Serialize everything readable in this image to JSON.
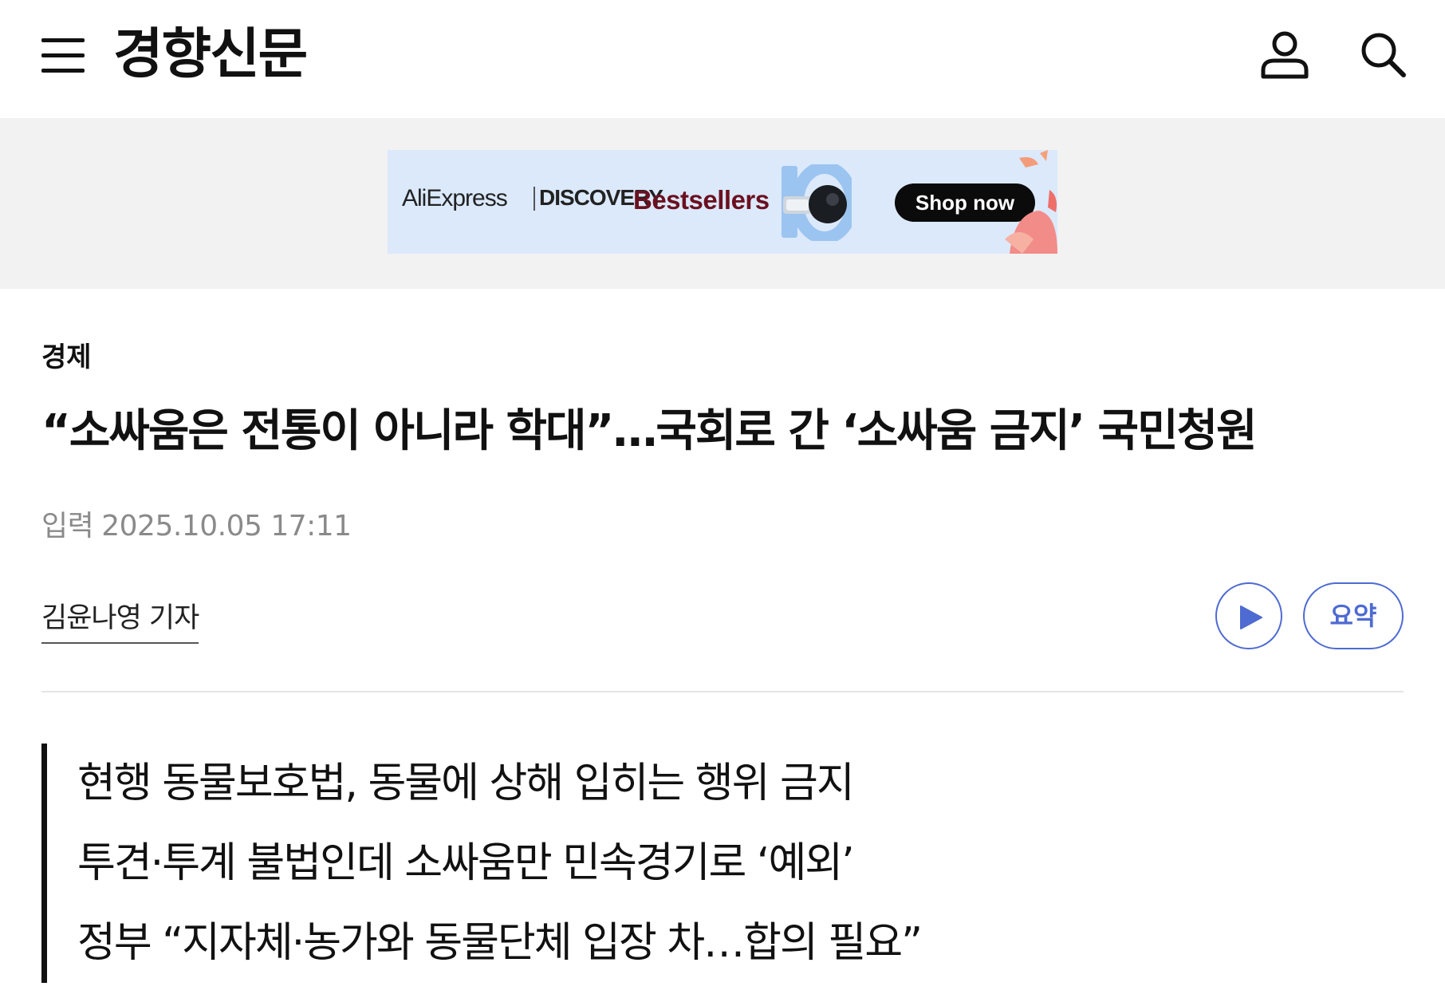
{
  "header": {
    "logo": "경향신문",
    "icons": [
      "menu-icon",
      "user-icon",
      "search-icon"
    ]
  },
  "ad": {
    "brand": "AliExpress",
    "brand_sub": "DISCOVERY",
    "headline": "Bestsellers",
    "cta": "Shop now"
  },
  "article": {
    "category": "경제",
    "title": "“소싸움은 전통이 아니라 학대”…국회로 간 ‘소싸움 금지’ 국민청원",
    "date_label": "입력",
    "date": "2025.10.05 17:11",
    "byline": "김윤나영 기자",
    "summary_label": "요약",
    "subheads": [
      "현행 동물보호법, 동물에 상해 입히는 행위 금지",
      "투견·투계 불법인데 소싸움만 민속경기로 ‘예외’",
      "정부 “지자체·농가와 동물단체 입장 차…합의 필요”"
    ]
  },
  "colors": {
    "accent": "#4e6bd1",
    "text": "#111111",
    "muted": "#8a8a8a",
    "ad_background": "#dbe9fb",
    "ad_headline": "#6b1020"
  }
}
